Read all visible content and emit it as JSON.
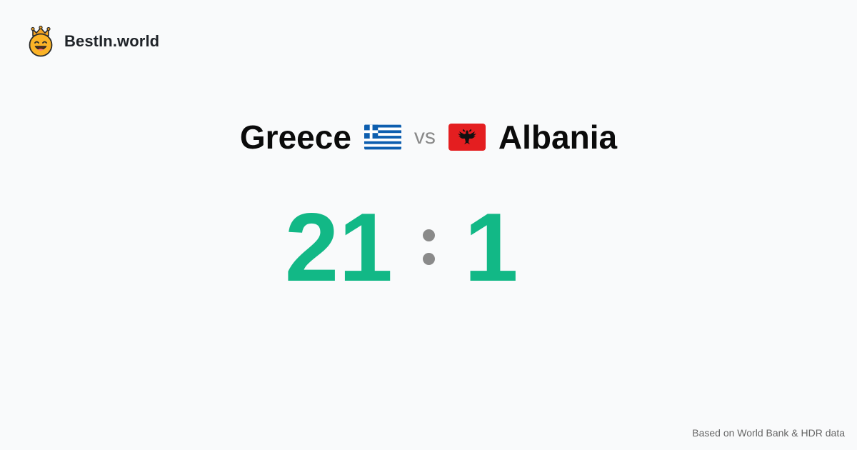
{
  "brand": {
    "name": "BestIn.world",
    "logo_icon": "crown-smiley-icon"
  },
  "comparison": {
    "left_country": "Greece",
    "left_flag_icon": "greece-flag-icon",
    "vs_label": "vs",
    "right_country": "Albania",
    "right_flag_icon": "albania-flag-icon"
  },
  "score": {
    "left": "21",
    "right": "1"
  },
  "footer": {
    "source_text": "Based on World Bank & HDR data"
  },
  "colors": {
    "score": "#12b886",
    "muted": "#8a8a8a",
    "background": "#f9fafb",
    "greece_blue": "#0d5eaf",
    "albania_red": "#e41e20"
  }
}
